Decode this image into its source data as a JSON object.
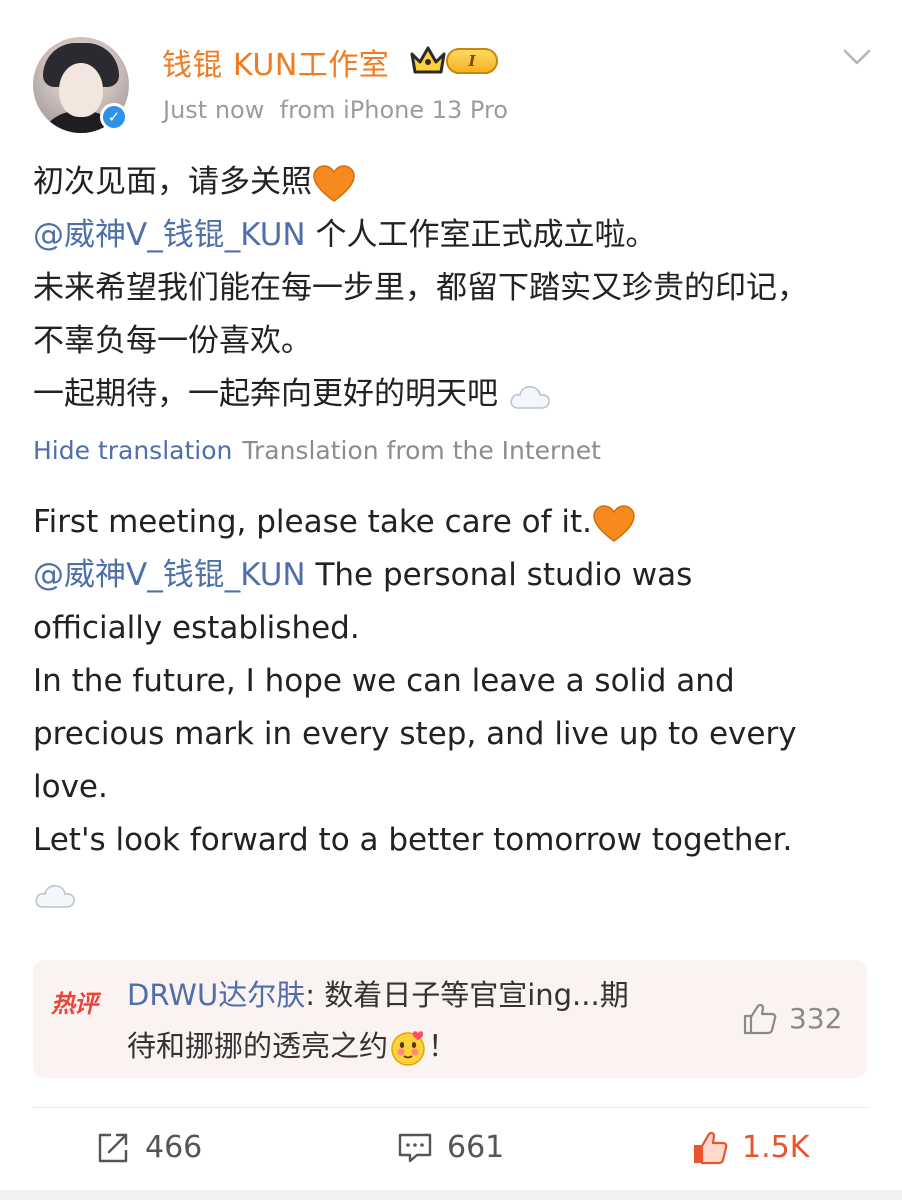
{
  "header": {
    "name": "钱锟 KUN工作室",
    "level_badge": "I",
    "time": "Just now",
    "source": "from iPhone 13 Pro"
  },
  "post_cn": {
    "line1": "初次见面，请多关照",
    "mention": "@威神V_钱锟_KUN",
    "line2_rest": " 个人工作室正式成立啦。",
    "line3": "未来希望我们能在每一步里，都留下踏实又珍贵的印记，",
    "line4": "不辜负每一份喜欢。",
    "line5": "一起期待，一起奔向更好的明天吧 "
  },
  "translation": {
    "hide_label": "Hide translation",
    "source_label": "Translation from the Internet"
  },
  "post_en": {
    "line1": "First meeting, please take care of it.",
    "mention": "@威神V_钱锟_KUN",
    "line2_rest": " The personal studio was",
    "line3": "officially established.",
    "line4": "In the future, I hope we can leave a solid and",
    "line5": "precious mark in every step, and live up to every",
    "line6": "love.",
    "line7": "Let's look forward to a better tomorrow together."
  },
  "hot_comment": {
    "tag": "热评",
    "user": "DRWU达尔肤",
    "text_line1": ": 数着日子等官宣ing...期",
    "text_line2": "待和挪挪的透亮之约",
    "text_end": "！",
    "likes": "332"
  },
  "actions": {
    "reposts": "466",
    "comments": "661",
    "likes": "1.5K"
  },
  "icons": {
    "verified": "verified-check-icon",
    "emoji_heart": "orange-heart-icon",
    "emoji_cloud": "cloud-icon",
    "colors": {
      "name": "#f27a1f",
      "link": "#4f6fa9",
      "like_active": "#e8542b",
      "hot_tag": "#e8463a"
    }
  }
}
